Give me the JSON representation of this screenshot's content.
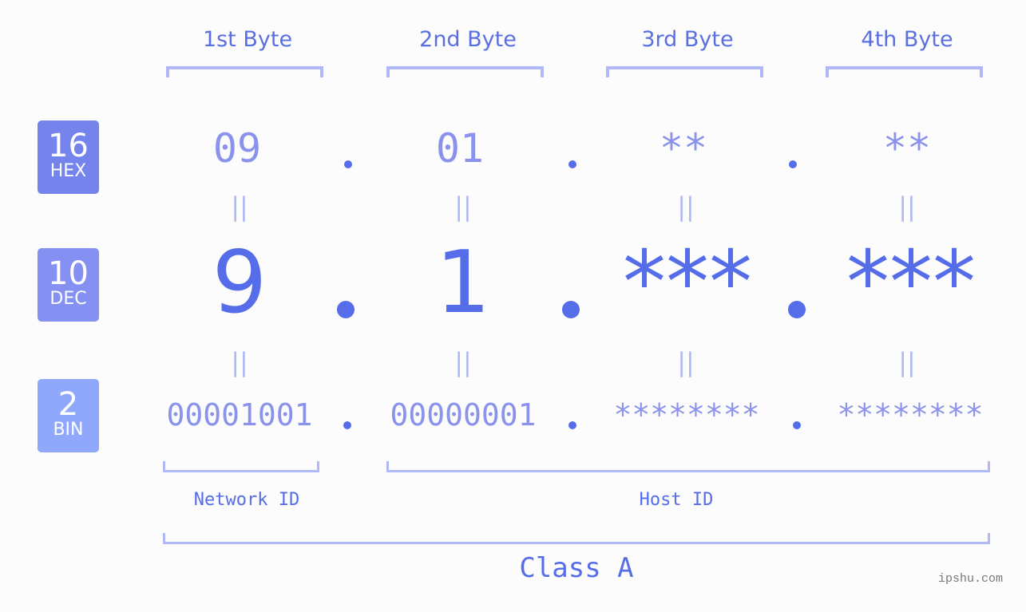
{
  "byte_headers": [
    "1st Byte",
    "2nd Byte",
    "3rd Byte",
    "4th Byte"
  ],
  "badges": [
    {
      "number": "16",
      "label": "HEX",
      "color": "#7583ec"
    },
    {
      "number": "10",
      "label": "DEC",
      "color": "#8591f2"
    },
    {
      "number": "2",
      "label": "BIN",
      "color": "#8fa8fb"
    }
  ],
  "hex": [
    "09",
    "01",
    "**",
    "**"
  ],
  "dec": [
    "9",
    "1",
    "***",
    "***"
  ],
  "bin": [
    "00001001",
    "00000001",
    "********",
    "********"
  ],
  "equals_sign": "||",
  "network_id_label": "Network ID",
  "host_id_label": "Host ID",
  "class_label": "Class A",
  "watermark": "ipshu.com",
  "colors": {
    "accent": "#566de9",
    "light_accent": "#b0b9f6",
    "muted": "#8a92ec"
  }
}
